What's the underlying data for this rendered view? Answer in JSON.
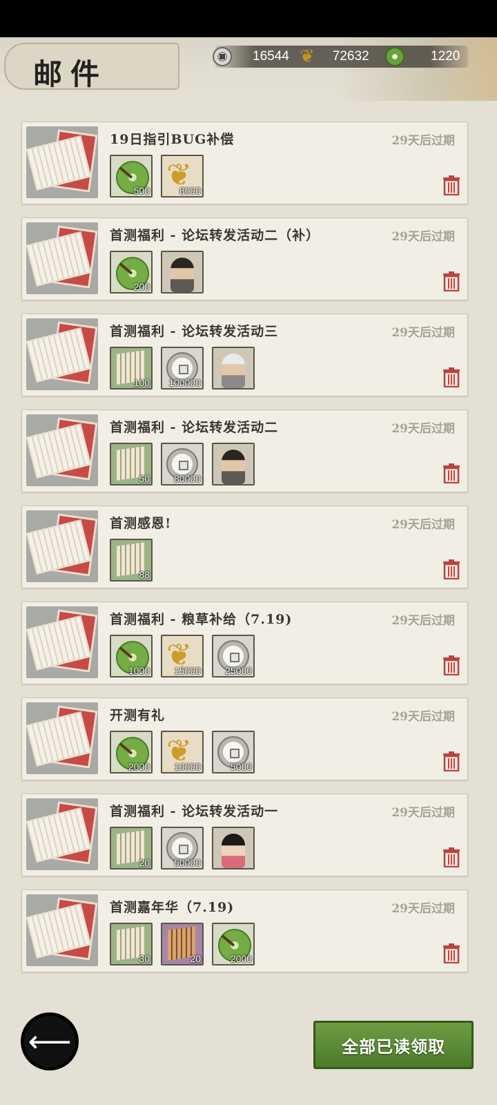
{
  "header": {
    "title": "邮件",
    "currencies": [
      {
        "icon": "silver-coin-icon",
        "value": "16544"
      },
      {
        "icon": "grain-icon",
        "value": "72632"
      },
      {
        "icon": "jade-coin-icon",
        "value": "1220"
      }
    ]
  },
  "mails": [
    {
      "title": "19日指引BUG补偿",
      "expiry": "29天后过期",
      "rewards": [
        {
          "type": "jade",
          "count": "500"
        },
        {
          "type": "grain",
          "count": "8000"
        }
      ]
    },
    {
      "title": "首测福利 - 论坛转发活动二（补）",
      "expiry": "29天后过期",
      "rewards": [
        {
          "type": "jade",
          "count": "200"
        },
        {
          "type": "hero",
          "count": ""
        }
      ]
    },
    {
      "title": "首测福利 - 论坛转发活动三",
      "expiry": "29天后过期",
      "rewards": [
        {
          "type": "scroll",
          "count": "100"
        },
        {
          "type": "silver",
          "count": "100000"
        },
        {
          "type": "hero-silver",
          "count": ""
        }
      ]
    },
    {
      "title": "首测福利 - 论坛转发活动二",
      "expiry": "29天后过期",
      "rewards": [
        {
          "type": "scroll",
          "count": "50"
        },
        {
          "type": "silver",
          "count": "80000"
        },
        {
          "type": "hero",
          "count": ""
        }
      ]
    },
    {
      "title": "首测感恩!",
      "expiry": "29天后过期",
      "rewards": [
        {
          "type": "scroll",
          "count": "88"
        }
      ]
    },
    {
      "title": "首测福利 - 粮草补给（7.19)",
      "expiry": "29天后过期",
      "rewards": [
        {
          "type": "jade",
          "count": "1000"
        },
        {
          "type": "grain",
          "count": "15000"
        },
        {
          "type": "silver",
          "count": "25000"
        }
      ]
    },
    {
      "title": "开测有礼",
      "expiry": "29天后过期",
      "rewards": [
        {
          "type": "jade",
          "count": "2000"
        },
        {
          "type": "grain",
          "count": "10000"
        },
        {
          "type": "silver",
          "count": "5000"
        }
      ]
    },
    {
      "title": "首测福利 - 论坛转发活动一",
      "expiry": "29天后过期",
      "rewards": [
        {
          "type": "scroll",
          "count": "20"
        },
        {
          "type": "silver",
          "count": "50000"
        },
        {
          "type": "hero-female",
          "count": ""
        }
      ]
    },
    {
      "title": "首测嘉年华（7.19)",
      "expiry": "29天后过期",
      "rewards": [
        {
          "type": "scroll",
          "count": "30"
        },
        {
          "type": "scroll-purple",
          "count": "20"
        },
        {
          "type": "jade",
          "count": "2000"
        }
      ]
    }
  ],
  "footer": {
    "back_icon": "back-arrow-icon",
    "claim_all_label": "全部已读领取"
  },
  "colors": {
    "background": "#e4e0d3",
    "card": "#f1eee5",
    "expiry_text": "#a8a293",
    "trash": "#c0433b",
    "claim_button": "#5a8a33"
  }
}
